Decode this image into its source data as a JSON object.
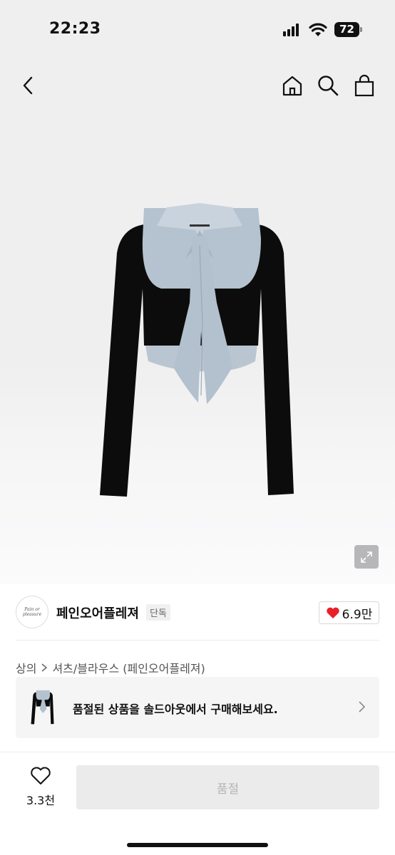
{
  "status_bar": {
    "time": "22:23",
    "battery": "72"
  },
  "nav": {
    "back_icon": "chevron-left-icon",
    "home_icon": "home-icon",
    "search_icon": "search-icon",
    "bag_icon": "shopping-bag-icon"
  },
  "product": {
    "image": "layered-shirt-cardigan",
    "expand_icon": "expand-icon"
  },
  "brand": {
    "logo_text": "Pain or pleasure",
    "name": "페인오어플레져",
    "tag": "단독",
    "likes": "6.9만",
    "heart_color": "#e8202a"
  },
  "breadcrumb": {
    "items": [
      "상의",
      "셔츠/블라우스 (페인오어플레져)"
    ]
  },
  "soldout_banner": {
    "text": "품절된 상품을 솔드아웃에서 구매해보세요."
  },
  "bottom_bar": {
    "wish_count": "3.3천",
    "buy_label": "품절"
  }
}
